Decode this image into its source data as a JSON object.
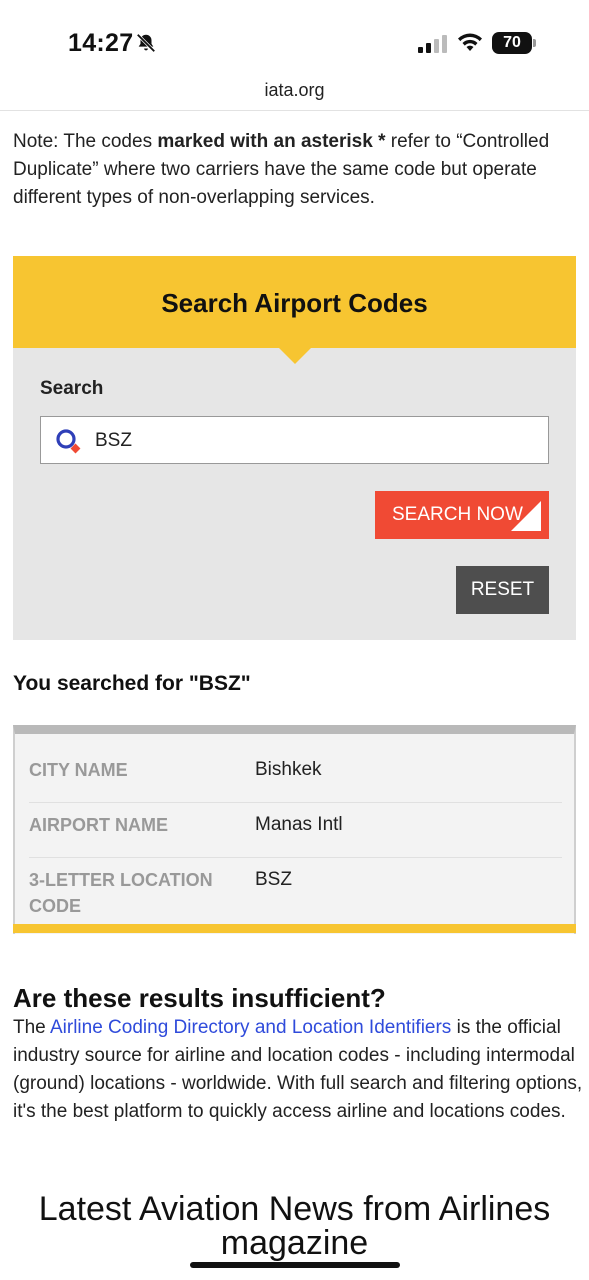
{
  "status_bar": {
    "time": "14:27",
    "battery": "70"
  },
  "browser": {
    "url": "iata.org"
  },
  "note": {
    "prefix": "Note: The codes ",
    "bold": "marked with an asterisk *",
    "suffix": " refer to “Controlled Duplicate” where two carriers have the same code but operate different types of non-overlapping services."
  },
  "search_panel": {
    "title": "Search Airport Codes",
    "search_label": "Search",
    "search_value": "BSZ",
    "search_button": "SEARCH NOW",
    "reset_button": "RESET"
  },
  "results": {
    "heading": "You searched for \"BSZ\"",
    "rows": [
      {
        "label": "CITY NAME",
        "value": "Bishkek"
      },
      {
        "label": "AIRPORT NAME",
        "value": "Manas Intl"
      },
      {
        "label": "3-LETTER LOCATION CODE",
        "value": "BSZ"
      }
    ]
  },
  "insufficient": {
    "title": "Are these results insufficient?",
    "text_prefix": "The ",
    "link": "Airline Coding Directory and Location Identifiers",
    "text_suffix": " is the official industry source for airline and location codes - including intermodal (ground) locations - worldwide. With full search and filtering options, it's the best platform to quickly access airline and locations codes."
  },
  "news": {
    "title": "Latest Aviation News from Airlines magazine"
  },
  "colors": {
    "accent_yellow": "#f7c531",
    "search_button": "#f04a34",
    "reset_button": "#4e4e4e",
    "link": "#2f4bdb"
  },
  "icons": [
    "bell-slash-icon",
    "cellular-signal-icon",
    "wifi-icon",
    "battery-icon",
    "search-icon"
  ]
}
